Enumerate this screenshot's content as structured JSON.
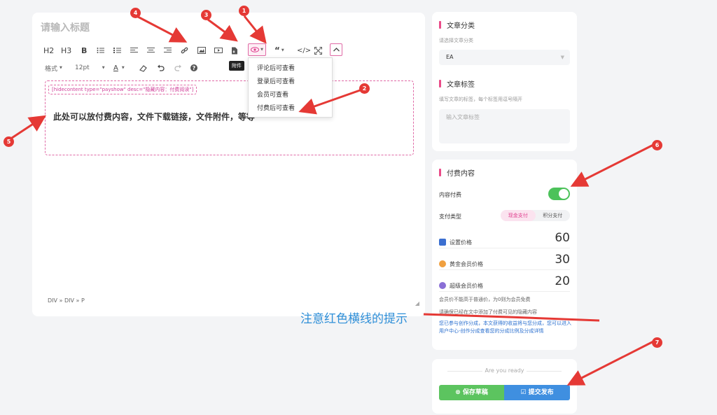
{
  "editor": {
    "title_placeholder": "请输入标题",
    "toolbar": {
      "h2": "H2",
      "h3": "H3",
      "bold": "B",
      "format": "格式",
      "font_size": "12pt",
      "font_color": "A"
    },
    "tooltip": "附件",
    "dropdown": [
      "评论后可查看",
      "登录后可查看",
      "会员可查看",
      "付费后可查看"
    ],
    "hidden_tag": "[hidecontent type=\"payshow\" desc=\"隐藏内容：付费阅读\"]",
    "hidden_body": "此处可以放付费内容，文件下载链接，文件附件，等等",
    "statusbar": "DIV » DIV » P"
  },
  "sidebar": {
    "category": {
      "title": "文章分类",
      "hint": "请选择文章分类",
      "selected": "EA"
    },
    "tags": {
      "title": "文章标签",
      "hint": "填写文章的标签，每个标签用逗号隔开",
      "placeholder": "输入文章标签"
    },
    "paid": {
      "title": "付费内容",
      "toggle_label": "内容付费",
      "toggle_on": true,
      "pay_type_label": "支付类型",
      "pay_options": [
        "现金支付",
        "积分支付"
      ],
      "prices": [
        {
          "label": "设置价格",
          "value": "60",
          "icon_color": "#3b6fd0"
        },
        {
          "label": "黄金会员价格",
          "value": "30",
          "icon_color": "#f0a040"
        },
        {
          "label": "超级会员价格",
          "value": "20",
          "icon_color": "#8a6fd6"
        }
      ],
      "note1": "会员价不能高于普通价，为0则为会员免费",
      "note2": "请确保已经在文中添加了付费可见的隐藏内容",
      "note3": "您已参与创作分成，本文获得的收益将与您分成，您可以进入用户中心-创作分成查看您的分成比例及分成详情"
    },
    "ready": {
      "text": "Are you ready",
      "save": "保存草稿",
      "publish": "提交发布"
    }
  },
  "annotation": {
    "text": "注意红色横线的提示",
    "badges": [
      "1",
      "2",
      "3",
      "4",
      "5",
      "6",
      "7"
    ],
    "color": "#e53935"
  }
}
